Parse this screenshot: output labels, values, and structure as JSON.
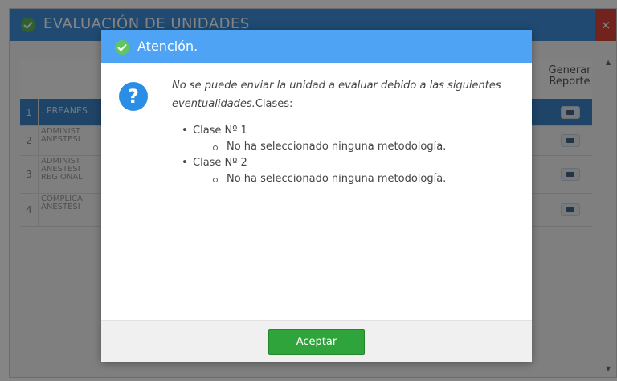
{
  "background": {
    "title": "EVALUACIÓN DE UNIDADES",
    "close_label": "×",
    "report_header": "Generar Reporte",
    "rows": [
      {
        "num": "1",
        "name": ". PREANES"
      },
      {
        "num": "2",
        "name": "ADMINIST\nANESTESI"
      },
      {
        "num": "3",
        "name": "ADMINIST\nANESTESI\nREGIONAL"
      },
      {
        "num": "4",
        "name": "COMPLICA\nANESTESI"
      }
    ]
  },
  "modal": {
    "title": "Atención.",
    "icon": "question-icon",
    "message_intro": "No se puede enviar la unidad a evaluar debido a las siguientes eventualidades.",
    "message_label": "Clases:",
    "classes": [
      {
        "name": "Clase Nº 1",
        "issue": "No ha seleccionado ninguna metodología."
      },
      {
        "name": "Clase Nº 2",
        "issue": "No ha seleccionado ninguna metodología."
      }
    ],
    "accept_label": "Aceptar"
  },
  "colors": {
    "header_blue": "#4fa3f5",
    "accept_green": "#2ea43a",
    "question_blue": "#2b8ee6"
  }
}
